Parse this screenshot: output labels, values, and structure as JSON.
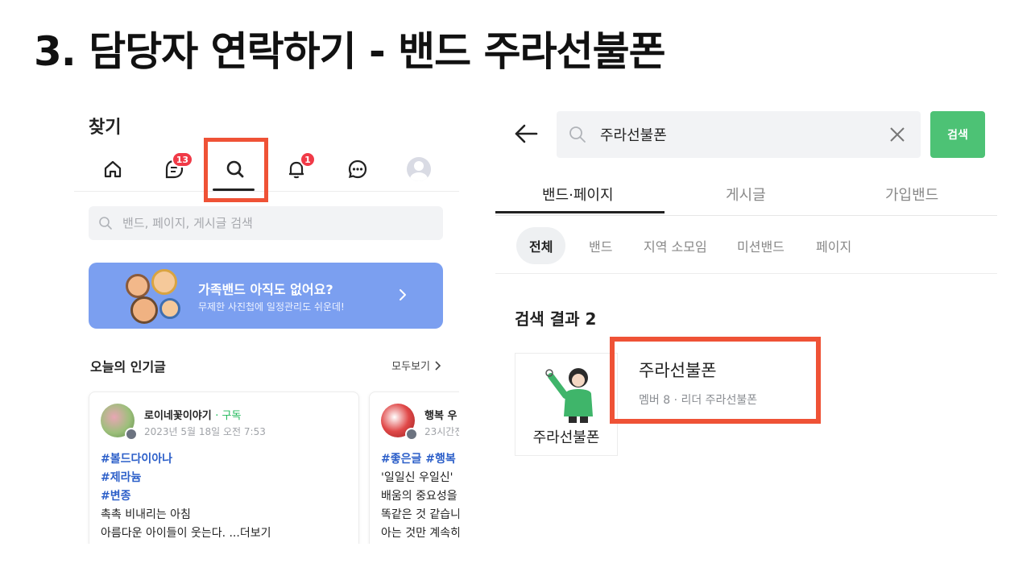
{
  "slide": {
    "title": "3. 담당자 연락하기 - 밴드 주라선불폰"
  },
  "left": {
    "find_title": "찾기",
    "nav": {
      "items": [
        {
          "icon": "home-icon"
        },
        {
          "icon": "feed-icon",
          "badge": "13"
        },
        {
          "icon": "search-icon"
        },
        {
          "icon": "bell-icon",
          "badge": "1"
        },
        {
          "icon": "chat-icon"
        },
        {
          "icon": "avatar-icon"
        }
      ]
    },
    "search": {
      "placeholder": "밴드, 페이지, 게시글 검색"
    },
    "banner": {
      "title": "가족밴드 아직도 없어요?",
      "subtitle": "무제한 사진첩에 일정관리도 쉬운데!"
    },
    "popular": {
      "title": "오늘의 인기글",
      "see_all": "모두보기"
    },
    "cards": [
      {
        "name": "로이네꽃이야기",
        "follow": "· 구독",
        "sub": "2023년 5월 18일 오전 7:53",
        "tags": [
          "#볼드다이아나",
          "#제라늄",
          "#변종"
        ],
        "lines": [
          "촉촉 비내리는 아침",
          "아름다운 아이들이 웃는다. ...더보기"
        ]
      },
      {
        "name": "행복 우",
        "sub": "23시간전",
        "tags": [
          "#좋은글 #행복"
        ],
        "lines": [
          "'일일신 우일신'",
          "배움의 중요성을",
          "똑같은 것 같습니",
          "아는 것만 계속히"
        ]
      }
    ]
  },
  "right": {
    "search": {
      "value": "주라선불폰",
      "button": "검색"
    },
    "tabs": [
      "밴드·페이지",
      "게시글",
      "가입밴드"
    ],
    "chips": [
      "전체",
      "밴드",
      "지역 소모임",
      "미션밴드",
      "페이지"
    ],
    "result_count": "검색 결과 2",
    "result": {
      "name": "주라선불폰",
      "meta": "멤버 8 · 리더 주라선불폰",
      "thumb_text": "주라선불폰"
    }
  },
  "colors": {
    "highlight": "#ef5236",
    "search_button": "#4dc275",
    "banner": "#7b9ff0",
    "badge": "#f03a47",
    "tag": "#2c5fc9"
  }
}
